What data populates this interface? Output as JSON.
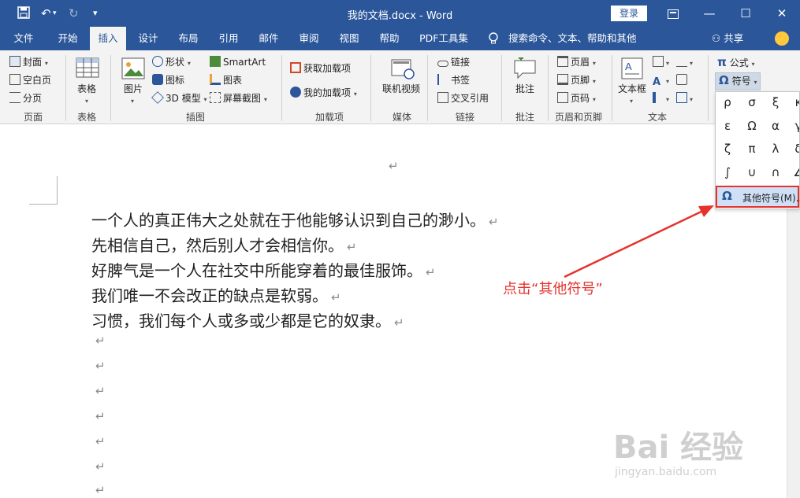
{
  "window": {
    "title": "我的文档.docx - Word",
    "login_label": "登录",
    "qa_save_icon": "save-icon",
    "qa_undo_icon": "undo-icon",
    "qa_redo_icon": "redo-icon"
  },
  "tabs": [
    "文件",
    "开始",
    "插入",
    "设计",
    "布局",
    "引用",
    "邮件",
    "审阅",
    "视图",
    "帮助",
    "PDF工具集"
  ],
  "active_tab": "插入",
  "tell_me": "搜索命令、文本、帮助和其他",
  "share": "共享",
  "ribbon": {
    "pages": {
      "cover": "封面",
      "blank": "空白页",
      "break": "分页",
      "group": "页面"
    },
    "table": {
      "label": "表格",
      "group": "表格"
    },
    "illustrations": {
      "picture": "图片",
      "shapes": "形状",
      "icons": "图标",
      "model3d": "3D 模型",
      "smartart": "SmartArt",
      "chart": "图表",
      "screenshot": "屏幕截图",
      "group": "插图"
    },
    "addins": {
      "get": "获取加载项",
      "mine": "我的加载项",
      "group": "加载项"
    },
    "media": {
      "video": "联机视频",
      "group": "媒体"
    },
    "links": {
      "link": "链接",
      "bookmark": "书签",
      "crossref": "交叉引用",
      "group": "链接"
    },
    "comments": {
      "comment": "批注",
      "group": "批注"
    },
    "header_footer": {
      "header": "页眉",
      "footer": "页脚",
      "page_number": "页码",
      "group": "页眉和页脚"
    },
    "text": {
      "textbox": "文本框",
      "group": "文本"
    },
    "symbols": {
      "equation": "公式",
      "symbol": "符号"
    }
  },
  "symbol_panel": {
    "rows": [
      [
        "ρ",
        "σ",
        "ξ",
        "κ"
      ],
      [
        "ε",
        "Ω",
        "α",
        "γ"
      ],
      [
        "ζ",
        "π",
        "λ",
        "δ"
      ],
      [
        "∫",
        "∪",
        "∩",
        "∠"
      ]
    ],
    "more_label": "其他符号(M)..."
  },
  "document": {
    "paragraphs": [
      "一个人的真正伟大之处就在于他能够认识到自己的渺小。",
      "先相信自己，然后别人才会相信你。",
      "好脾气是一个人在社交中所能穿着的最佳服饰。",
      "我们唯一不会改正的缺点是软弱。",
      "习惯，我们每个人或多或少都是它的奴隶。"
    ],
    "mark": "↵"
  },
  "annotation": "点击“其他符号”",
  "watermark": {
    "brand": "Bai 经验",
    "url": "jingyan.baidu.com"
  },
  "colors": {
    "accent": "#2b579a",
    "highlight": "#e6322c"
  }
}
